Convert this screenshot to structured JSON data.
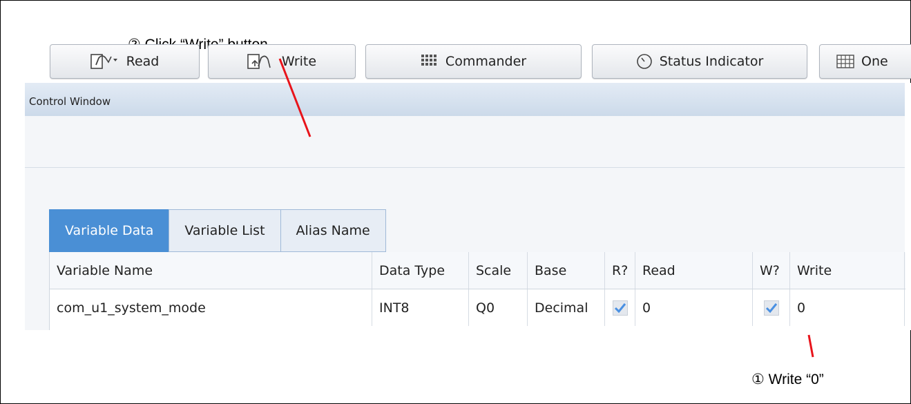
{
  "annotations": {
    "step2": "② Click “Write” button",
    "step1": "① Write “0”"
  },
  "window": {
    "title": "Control Window"
  },
  "toolbar": {
    "buttons": [
      {
        "label": "Read",
        "icon": "read-icon"
      },
      {
        "label": "Write",
        "icon": "write-icon"
      },
      {
        "label": "Commander",
        "icon": "commander-grid-icon"
      },
      {
        "label": "Status Indicator",
        "icon": "status-indicator-icon"
      },
      {
        "label": "One",
        "icon": "table-icon"
      }
    ]
  },
  "tabs": [
    {
      "label": "Variable Data",
      "active": true
    },
    {
      "label": "Variable List",
      "active": false
    },
    {
      "label": "Alias Name",
      "active": false
    }
  ],
  "table": {
    "columns": [
      "Variable Name",
      "Data Type",
      "Scale",
      "Base",
      "R?",
      "Read",
      "W?",
      "Write"
    ],
    "rows": [
      {
        "name": "com_u1_system_mode",
        "data_type": "INT8",
        "scale": "Q0",
        "base": "Decimal",
        "read_checked": true,
        "read": "0",
        "write_checked": true,
        "write": "0"
      }
    ]
  },
  "colors": {
    "active_tab": "#4a8fd5",
    "annotation_line": "#e8141b",
    "checkmark": "#4a90e2",
    "titlebar": "#d4e0ee"
  }
}
